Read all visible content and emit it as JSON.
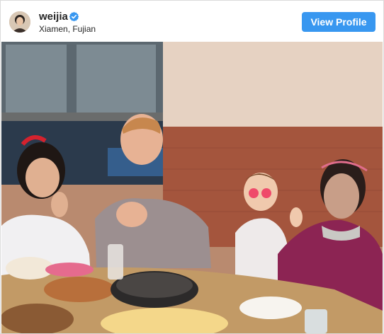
{
  "post": {
    "username": "weijia",
    "verified": true,
    "location": "Xiamen, Fujian",
    "view_profile_label": "View Profile"
  },
  "photo": {
    "subject": "family-dinner-photo"
  },
  "colors": {
    "button": "#3897f0",
    "verified_badge": "#3897f0",
    "text": "#262626",
    "border": "#dbdbdb"
  },
  "icons": {
    "verified": "verified-badge-icon"
  }
}
